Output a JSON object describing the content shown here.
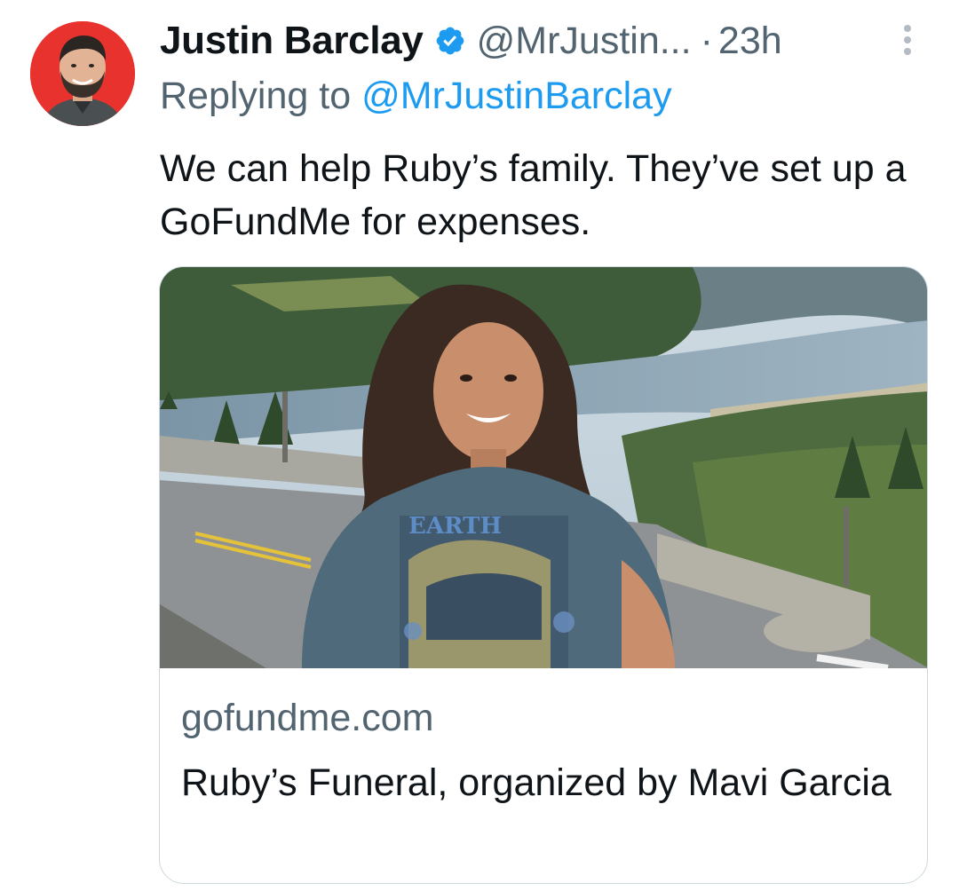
{
  "tweet": {
    "author": {
      "display_name": "Justin Barclay",
      "handle": "@MrJustin...",
      "verified_icon": "verified-badge-icon",
      "avatar_bg": "#e8322e"
    },
    "separator": "·",
    "time": "23h",
    "more_icon": "more-options-icon",
    "replying_prefix": "Replying to",
    "replying_to": "@MrJustinBarclay",
    "text": "We can help Ruby’s family. They’ve set up a GoFundMe for expenses.",
    "card": {
      "domain": "gofundme.com",
      "title": "Ruby’s Funeral, organized by Mavi Garcia"
    }
  },
  "colors": {
    "text_primary": "#0f1419",
    "text_secondary": "#536471",
    "link": "#1d9bf0",
    "verified": "#1d9bf0",
    "border": "#cfd9de"
  }
}
